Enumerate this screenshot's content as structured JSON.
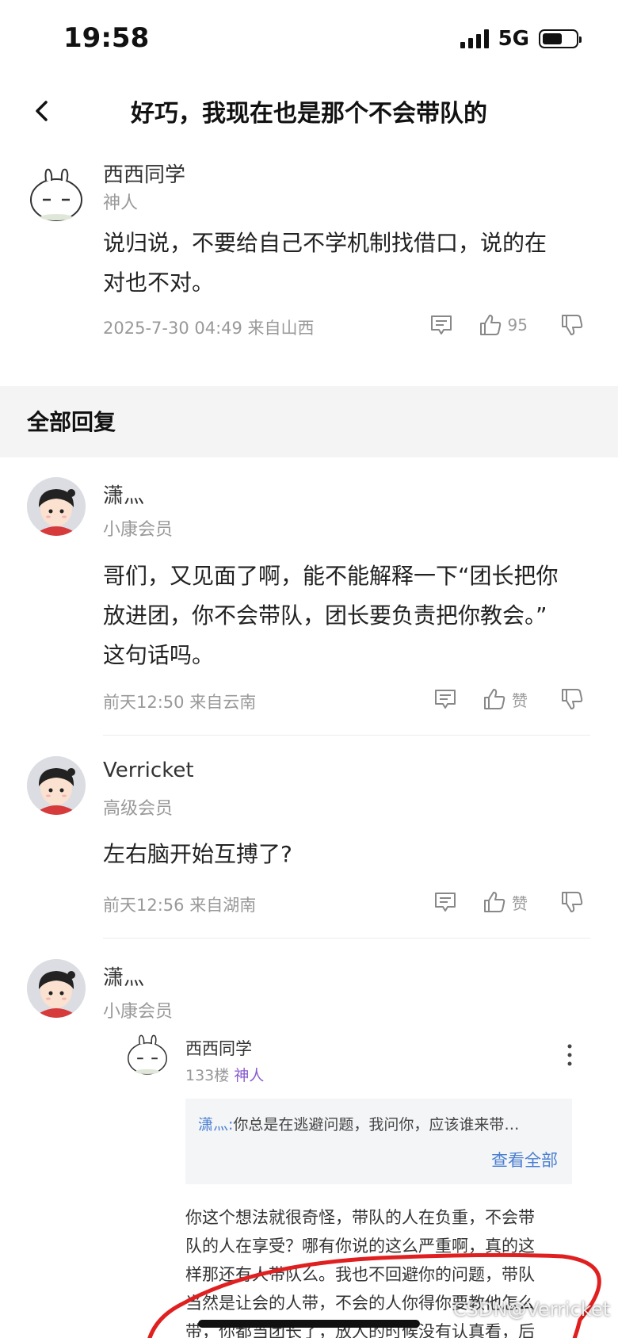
{
  "status": {
    "time": "19:58",
    "network": "5G"
  },
  "nav": {
    "title": "好巧，我现在也是那个不会带队的"
  },
  "main_post": {
    "user": "西西同学",
    "rank": "神人",
    "text_line1": "说归说，不要给自己不学机制找借口，说的在",
    "text_line2": "对也不对。",
    "meta": "2025-7-30 04:49  来自山西",
    "likes": "95"
  },
  "section": {
    "title": "全部回复"
  },
  "replies": [
    {
      "user": "潇灬",
      "rank": "小康会员",
      "text_line1": "哥们，又见面了啊，能不能解释一下“团长把你",
      "text_line2": "放进团，你不会带队，团长要负责把你教会。”",
      "text_line3": "这句话吗。",
      "meta": "前天12:50 来自云南",
      "like_label": "赞"
    },
    {
      "user": "Verricket",
      "rank": "高级会员",
      "text_line1": "左右脑开始互搏了?",
      "meta": "前天12:56 来自湖南",
      "like_label": "赞"
    },
    {
      "user": "潇灬",
      "rank": "小康会员"
    }
  ],
  "nested": {
    "user": "西西同学",
    "floor": "133楼",
    "rank": "神人",
    "quote_user": "潇灬:",
    "quote_text": "你总是在逃避问题，我问你，应该谁来带…",
    "quote_more": "查看全部",
    "reply_line1": "你这个想法就很奇怪，带队的人在负重，不会带",
    "reply_line2": "队的人在享受？哪有你说的这么严重啊，真的这",
    "reply_line3": "样那还有人带队么。我也不回避你的问题，带队",
    "reply_line4": "当然是让会的人带，不会的人你得你要教他怎么",
    "reply_line5": "带，你都当团长了，放人的时候没有认真看，后"
  },
  "watermark": "CSDN@Verricket",
  "colors": {
    "link": "#4a7fd1",
    "rank_purple": "#8a5cd0",
    "annotation_red": "#e02020"
  }
}
